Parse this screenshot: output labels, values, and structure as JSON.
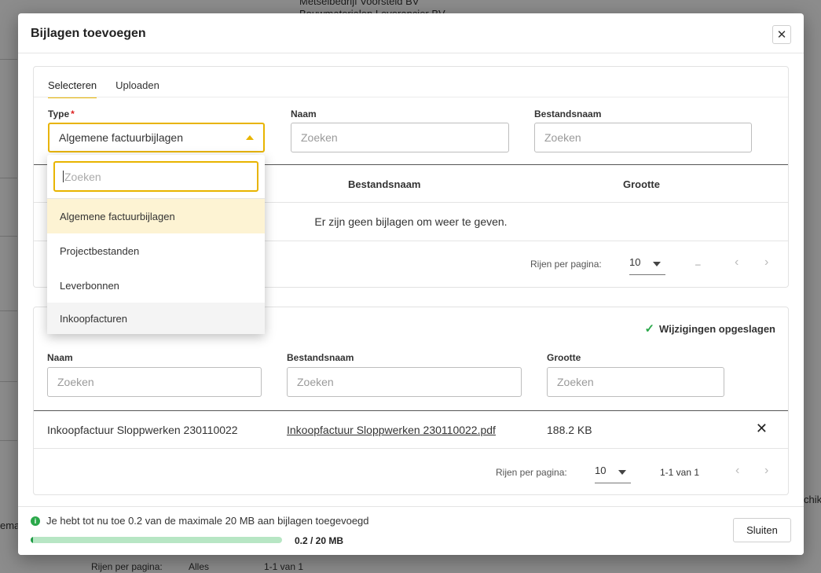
{
  "background": {
    "text_1": "Metselbedrijf Voorsteld BV",
    "text_2": "Bouwmaterialen Leverancier BV",
    "footer_rows_label": "Rijen per pagina:",
    "footer_rows_value": "Alles",
    "footer_range": "1-1 van 1",
    "left_cut": "ema",
    "right_cut": "chik"
  },
  "modal": {
    "title": "Bijlagen toevoegen",
    "close_icon": "close-icon",
    "tabs": [
      {
        "label": "Selecteren",
        "active": true
      },
      {
        "label": "Uploaden",
        "active": false
      }
    ],
    "filters": {
      "type_label": "Type",
      "type_required": "*",
      "type_value": "Algemene factuurbijlagen",
      "name_label": "Naam",
      "name_placeholder": "Zoeken",
      "filename_label": "Bestandsnaam",
      "filename_placeholder": "Zoeken"
    },
    "table1": {
      "columns": [
        "Bestandsnaam",
        "Grootte"
      ],
      "empty_message": "Er zijn geen bijlagen om weer te geven.",
      "rows_per_page_label": "Rijen per pagina:",
      "rows_per_page_value": "10",
      "range": "–"
    },
    "dropdown": {
      "search_placeholder": "Zoeken",
      "options": [
        "Algemene factuurbijlagen",
        "Projectbestanden",
        "Leverbonnen",
        "Inkoopfacturen"
      ],
      "selected_index": 0
    },
    "section2": {
      "saved_text": "Wijzigingen opgeslagen",
      "filters": {
        "name_label": "Naam",
        "name_placeholder": "Zoeken",
        "filename_label": "Bestandsnaam",
        "filename_placeholder": "Zoeken",
        "size_label": "Grootte",
        "size_placeholder": "Zoeken"
      },
      "rows": [
        {
          "name": "Inkoopfactuur Sloppwerken 230110022",
          "filename": "Inkoopfactuur Sloppwerken 230110022.pdf",
          "size": "188.2 KB"
        }
      ],
      "rows_per_page_label": "Rijen per pagina:",
      "rows_per_page_value": "10",
      "range": "1-1 van 1"
    },
    "footer": {
      "info_text": "Je hebt tot nu toe 0.2 van de maximale 20 MB aan bijlagen toegevoegd",
      "progress_fraction": 0.01,
      "progress_text": "0.2 / 20 MB",
      "close_label": "Sluiten"
    }
  },
  "colors": {
    "accent": "#e8b400",
    "success": "#2aa84a"
  }
}
